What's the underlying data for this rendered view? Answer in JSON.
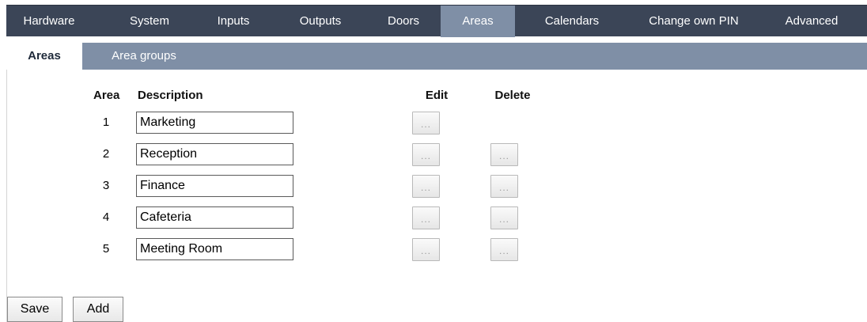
{
  "top_tabs": [
    "Hardware",
    "System",
    "Inputs",
    "Outputs",
    "Doors",
    "Areas",
    "Calendars",
    "Change own PIN",
    "Advanced"
  ],
  "sub_tabs": [
    "Areas",
    "Area groups"
  ],
  "table": {
    "headers": {
      "area": "Area",
      "description": "Description",
      "edit": "Edit",
      "delete": "Delete"
    },
    "rows": [
      {
        "area": "1",
        "description": "Marketing",
        "edit_label": "...",
        "delete_label": ""
      },
      {
        "area": "2",
        "description": "Reception",
        "edit_label": "...",
        "delete_label": "..."
      },
      {
        "area": "3",
        "description": "Finance",
        "edit_label": "...",
        "delete_label": "..."
      },
      {
        "area": "4",
        "description": "Cafeteria",
        "edit_label": "...",
        "delete_label": "..."
      },
      {
        "area": "5",
        "description": "Meeting Room",
        "edit_label": "...",
        "delete_label": "..."
      }
    ]
  },
  "buttons": {
    "save": "Save",
    "add": "Add"
  },
  "colors": {
    "nav_dark": "#3b4557",
    "nav_light": "#7f8fa6"
  }
}
